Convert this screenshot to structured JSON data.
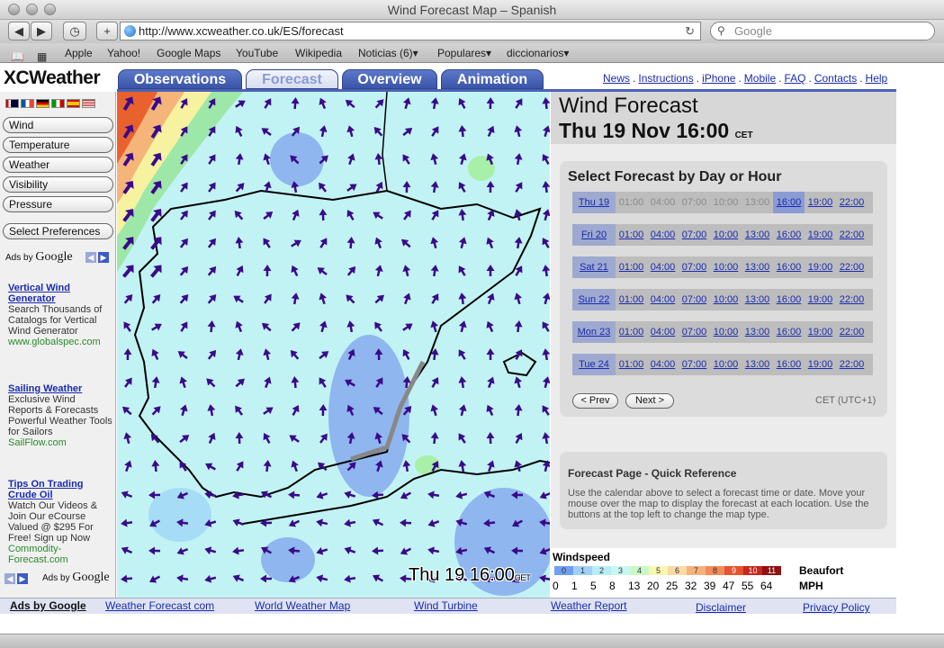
{
  "window": {
    "title": "Wind Forecast Map – Spanish"
  },
  "toolbar": {
    "url": "http://www.xcweather.co.uk/ES/forecast",
    "search_placeholder": "Google"
  },
  "bookmarks": [
    "Apple",
    "Yahoo!",
    "Google Maps",
    "YouTube",
    "Wikipedia",
    "Noticias (6)▾",
    "Populares▾",
    "diccionarios▾"
  ],
  "site": {
    "logo": "XCWeather",
    "tabs": [
      "Observations",
      "Forecast",
      "Overview",
      "Animation"
    ],
    "links": [
      "News",
      "Instructions",
      "iPhone",
      "Mobile",
      "FAQ",
      "Contacts",
      "Help"
    ]
  },
  "sidebar": {
    "buttons": [
      "Wind",
      "Temperature",
      "Weather",
      "Visibility",
      "Pressure"
    ],
    "prefs": "Select Preferences",
    "ads_by": "Ads by",
    "google": "Google",
    "ads": [
      {
        "title": "Vertical Wind Generator",
        "body": "Search Thousands of Catalogs for Vertical Wind Generator",
        "url": "www.globalspec.com"
      },
      {
        "title": "Sailing Weather",
        "body": "Exclusive Wind Reports & Forecasts Powerful Weather Tools for Sailors",
        "url": "SailFlow.com"
      },
      {
        "title": "Tips On Trading Crude Oil",
        "body": "Watch Our Videos & Join Our eCourse Valued @ $295 For Free! Sign up Now",
        "url": "Commodity-Forecast.com"
      }
    ]
  },
  "map": {
    "stamp_day": "Thu 19",
    "stamp_time": "16:00",
    "stamp_tz": "CET"
  },
  "forecast": {
    "heading": "Wind Forecast",
    "datetime": "Thu 19 Nov 16:00",
    "tz": "CET",
    "select_title": "Select Forecast by Day or Hour",
    "days": [
      {
        "day": "Thu 19",
        "hours": [
          "01:00",
          "04:00",
          "07:00",
          "10:00",
          "13:00",
          "16:00",
          "19:00",
          "22:00"
        ]
      },
      {
        "day": "Fri 20",
        "hours": [
          "01:00",
          "04:00",
          "07:00",
          "10:00",
          "13:00",
          "16:00",
          "19:00",
          "22:00"
        ]
      },
      {
        "day": "Sat 21",
        "hours": [
          "01:00",
          "04:00",
          "07:00",
          "10:00",
          "13:00",
          "16:00",
          "19:00",
          "22:00"
        ]
      },
      {
        "day": "Sun 22",
        "hours": [
          "01:00",
          "04:00",
          "07:00",
          "10:00",
          "13:00",
          "16:00",
          "19:00",
          "22:00"
        ]
      },
      {
        "day": "Mon 23",
        "hours": [
          "01:00",
          "04:00",
          "07:00",
          "10:00",
          "13:00",
          "16:00",
          "19:00",
          "22:00"
        ]
      },
      {
        "day": "Tue 24",
        "hours": [
          "01:00",
          "04:00",
          "07:00",
          "10:00",
          "13:00",
          "16:00",
          "19:00",
          "22:00"
        ]
      }
    ],
    "prev": "< Prev",
    "next": "Next >",
    "timezone": "CET (UTC+1)"
  },
  "quickref": {
    "title": "Forecast Page - Quick Reference",
    "body": "Use the calendar above to select a forecast time or date. Move your mouse over the map to display the forecast at each location. Use the buttons at the top left to change the map type."
  },
  "legend": {
    "title": "Windspeed",
    "beaufort": [
      "0",
      "1",
      "2",
      "3",
      "4",
      "5",
      "6",
      "7",
      "8",
      "9",
      "10",
      "11"
    ],
    "colors": [
      "#6f9ff0",
      "#9fd0f7",
      "#b9ecf6",
      "#c8f7f2",
      "#c9f7c6",
      "#f9f7b0",
      "#f9d9a6",
      "#f6b27c",
      "#f08b5a",
      "#e4542e",
      "#c9261d",
      "#8e1010"
    ],
    "unit1": "Beaufort",
    "mph": [
      "0",
      "1",
      "5",
      "8",
      "13",
      "20",
      "25",
      "32",
      "39",
      "47",
      "55",
      "64"
    ],
    "unit2": "MPH"
  },
  "footer": {
    "ads": "Ads by Google",
    "links": [
      "Weather Forecast com",
      "World Weather Map",
      "Wind Turbine",
      "Weather Report",
      "Disclaimer",
      "Privacy Policy"
    ]
  }
}
